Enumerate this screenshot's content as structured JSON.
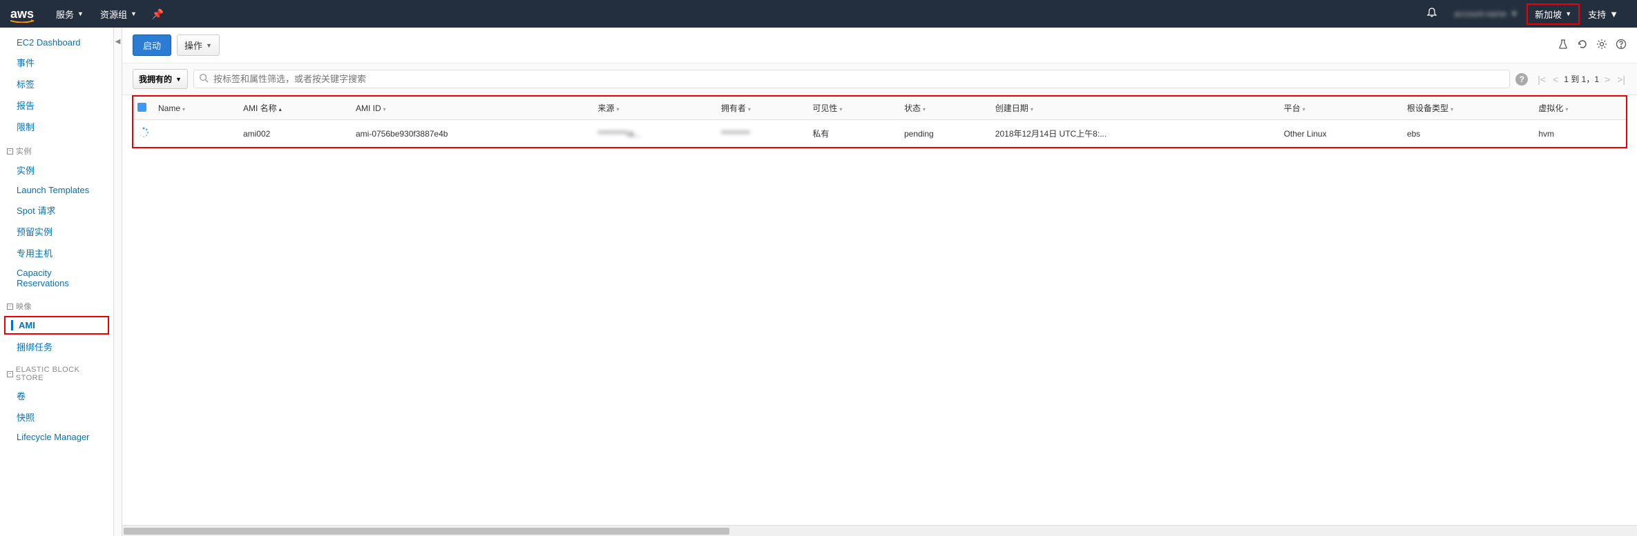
{
  "header": {
    "logo_text": "aws",
    "services": "服务",
    "resource_groups": "资源组",
    "account": "account-name",
    "region": "新加坡",
    "support": "支持"
  },
  "sidebar": {
    "items_top": [
      "EC2 Dashboard",
      "事件",
      "标签",
      "报告",
      "限制"
    ],
    "section_instances": "实例",
    "items_instances": [
      "实例",
      "Launch Templates",
      "Spot 请求",
      "预留实例",
      "专用主机",
      "Capacity Reservations"
    ],
    "section_images": "映像",
    "items_images_active": "AMI",
    "items_images_rest": [
      "捆绑任务"
    ],
    "section_ebs": "ELASTIC BLOCK STORE",
    "items_ebs": [
      "卷",
      "快照",
      "Lifecycle Manager"
    ]
  },
  "toolbar": {
    "launch": "启动",
    "actions": "操作"
  },
  "filter": {
    "owner": "我拥有的",
    "search_placeholder": "按标签和属性筛选，或者按关键字搜索",
    "pagination": "1 到 1，1"
  },
  "table": {
    "headers": [
      "Name",
      "AMI 名称",
      "AMI ID",
      "来源",
      "拥有者",
      "可见性",
      "状态",
      "创建日期",
      "平台",
      "根设备类型",
      "虚拟化"
    ],
    "row": {
      "name": "",
      "ami_name": "ami002",
      "ami_id": "ami-0756be930f3887e4b",
      "source": "*********/a...",
      "owner": "*********",
      "visibility": "私有",
      "status": "pending",
      "created": "2018年12月14日 UTC上午8:...",
      "platform": "Other Linux",
      "root_device": "ebs",
      "virtualization": "hvm"
    }
  }
}
